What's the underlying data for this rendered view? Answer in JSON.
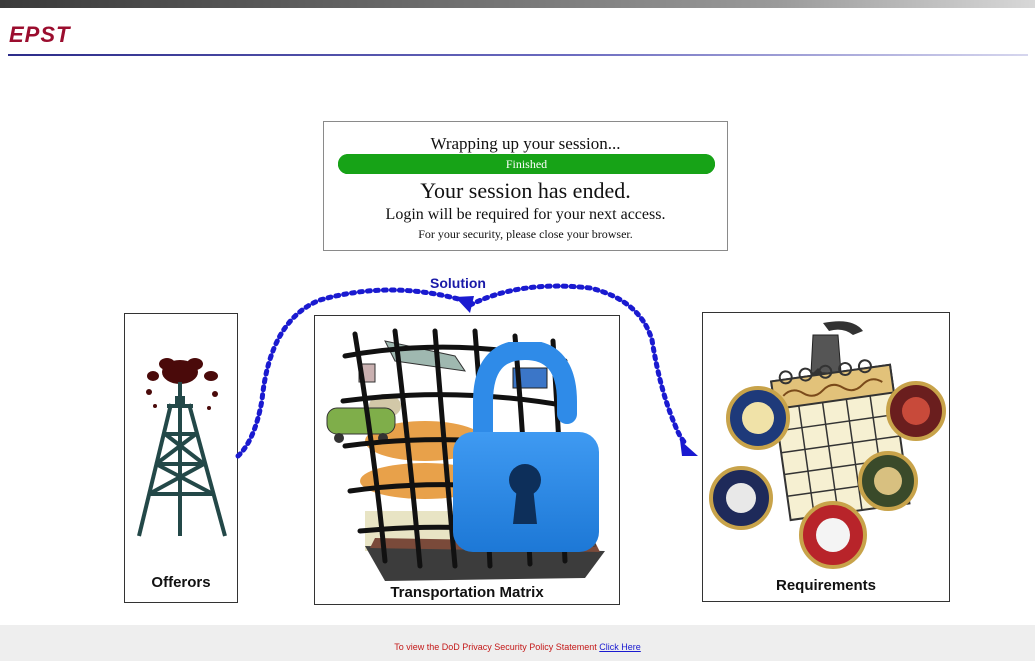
{
  "header": {
    "brand": "EPST"
  },
  "session": {
    "wrapping_message": "Wrapping up your session...",
    "progress_label": "Finished",
    "progress": 1.0,
    "ended_message": "Your session has ended.",
    "login_message": "Login will be required for your next access.",
    "security_message": "For your security, please close your browser."
  },
  "diagram": {
    "solution_label": "Solution",
    "panels": {
      "offerors": {
        "label": "Offerors"
      },
      "matrix": {
        "label": "Transportation Matrix"
      },
      "requirements": {
        "label": "Requirements"
      }
    },
    "icons": [
      "oil-derrick-icon",
      "transport-grid-icon",
      "padlock-icon",
      "fuel-calendar-icon",
      "military-seal-icon"
    ]
  },
  "footer": {
    "text": "To view the DoD Privacy Security Policy Statement",
    "link_text": "Click Here"
  },
  "colors": {
    "brand": "#9b0d2e",
    "progress": "#1f9a1f",
    "arrows": "#1a1ad0",
    "lock": "#2d8ae8",
    "footer_text": "#c41a1a"
  }
}
